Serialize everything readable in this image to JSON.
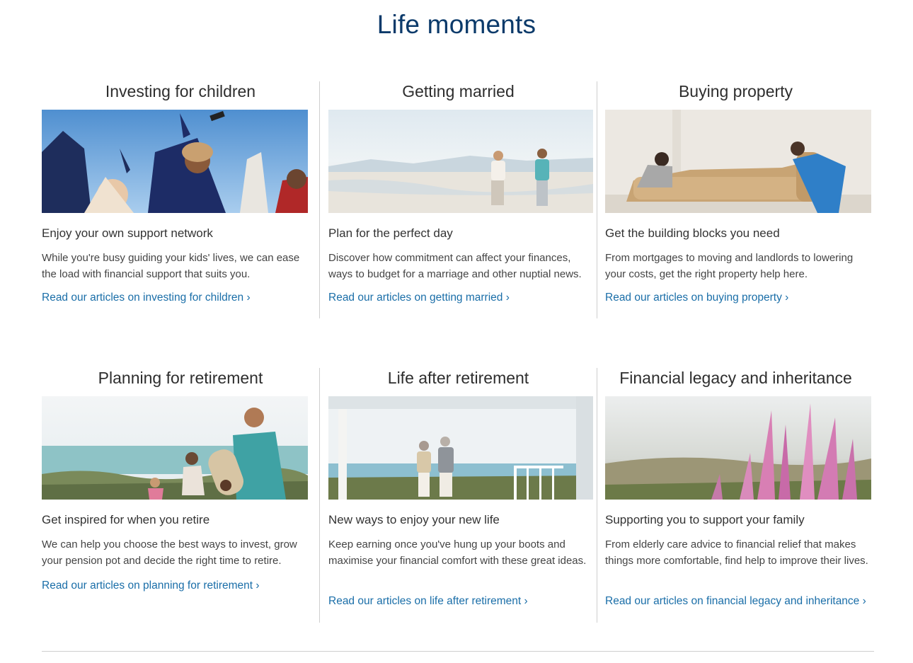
{
  "title": "Life moments",
  "colors": {
    "title": "#0b3a6a",
    "link": "#1a6ea8",
    "divider": "#cfcfcf"
  },
  "rows": [
    [
      {
        "heading": "Investing for children",
        "image": "graduation-photo",
        "subheading": "Enjoy your own support network",
        "description": "While you're busy guiding your kids' lives, we can ease the load with financial support that suits you.",
        "link": "Read our articles on investing for children ›"
      },
      {
        "heading": "Getting married",
        "image": "beach-couple-photo",
        "subheading": "Plan for the perfect day",
        "description": "Discover how commitment can affect your finances, ways to budget for a marriage and other nuptial news.",
        "link": "Read our articles on getting married ›"
      },
      {
        "heading": "Buying property",
        "image": "moving-sofa-photo",
        "subheading": "Get the building blocks you need",
        "description": "From mortgages to moving and landlords to lowering your costs, get the right property help here.",
        "link": "Read our articles on buying property ›"
      }
    ],
    [
      {
        "heading": "Planning for retirement",
        "image": "family-coast-photo",
        "subheading": "Get inspired for when you retire",
        "description": "We can help you choose the best ways to invest, grow your pension pot and decide the right time to retire.",
        "link": "Read our articles on planning for retirement ›"
      },
      {
        "heading": "Life after retirement",
        "image": "porch-couple-photo",
        "subheading": "New ways to enjoy your new life",
        "description": "Keep earning once you've hung up your boots and maximise your financial comfort with these great ideas.",
        "link": "Read our articles on life after retirement ›"
      },
      {
        "heading": "Financial legacy and inheritance",
        "image": "heather-flowers-photo",
        "subheading": "Supporting you to support your family",
        "description": "From elderly care advice to financial relief that makes things more comfortable, find help to improve their lives.",
        "link": "Read our articles on financial legacy and inheritance ›"
      }
    ]
  ]
}
